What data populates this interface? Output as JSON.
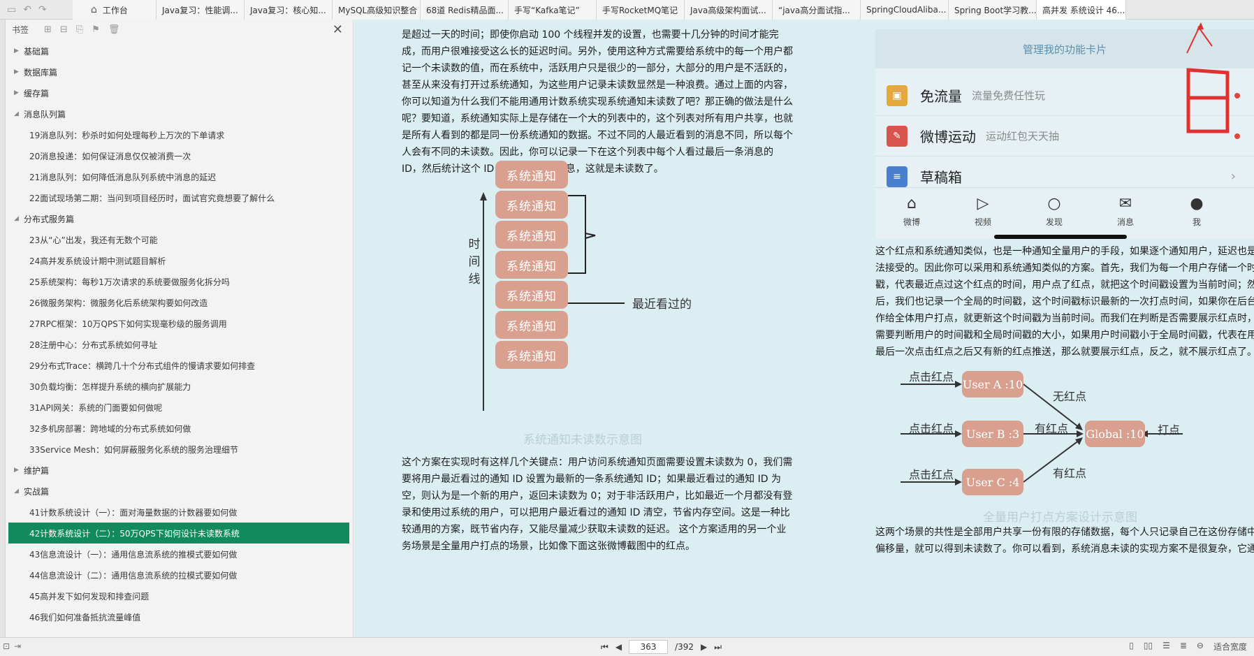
{
  "tabs": {
    "home": "工作台",
    "items": [
      "Java复习：性能调...",
      "Java复习：核心知...",
      "MySQL高级知识整合",
      "68道 Redis精品面...",
      "手写“Kafka笔记”",
      "手写RocketMQ笔记",
      "Java高级架构面试...",
      "“java高分面试指...",
      "SpringCloudAliba...",
      "Spring Boot学习教...",
      "高并发 系统设计 46..."
    ]
  },
  "sidebar": {
    "title": "书签",
    "sections": [
      {
        "label": "基础篇",
        "expanded": false,
        "items": []
      },
      {
        "label": "数据库篇",
        "expanded": false,
        "items": []
      },
      {
        "label": "缓存篇",
        "expanded": false,
        "items": []
      },
      {
        "label": "消息队列篇",
        "expanded": true,
        "items": [
          "19消息队列：秒杀时如何处理每秒上万次的下单请求",
          "20消息投递：如何保证消息仅仅被消费一次",
          "21消息队列：如何降低消息队列系统中消息的延迟",
          "22面试现场第二期：当问到项目经历时，面试官究竟想要了解什么"
        ]
      },
      {
        "label": "分布式服务篇",
        "expanded": true,
        "items": [
          "23从“心”出发，我还有无数个可能",
          "24高并发系统设计期中测试题目解析",
          "25系统架构：每秒1万次请求的系统要做服务化拆分吗",
          "26微服务架构：微服务化后系统架构要如何改造",
          "27RPC框架：10万QPS下如何实现毫秒级的服务调用",
          "28注册中心：分布式系统如何寻址",
          "29分布式Trace：横跨几十个分布式组件的慢请求要如何排查",
          "30负载均衡：怎样提升系统的横向扩展能力",
          "31API网关：系统的门面要如何做呢",
          "32多机房部署：跨地域的分布式系统如何做",
          "33Service Mesh：如何屏蔽服务化系统的服务治理细节"
        ]
      },
      {
        "label": "维护篇",
        "expanded": false,
        "items": []
      },
      {
        "label": "实战篇",
        "expanded": true,
        "items": [
          "41计数系统设计（一）：面对海量数据的计数器要如何做",
          "42计数系统设计（二）：50万QPS下如何设计未读数系统",
          "43信息流设计（一）：通用信息流系统的推模式要如何做",
          "44信息流设计（二）：通用信息流系统的拉模式要如何做",
          "45高并发下如何发现和排查问题",
          "46我们如何准备抵抗流量峰值"
        ]
      }
    ],
    "selected": "42计数系统设计（二）：50万QPS下如何设计未读数系统"
  },
  "content": {
    "para1": [
      "是超过一天的时间；即使你启动 100 个线程并发的设置，也需要十几分钟的时间才能完",
      "成，而用户很难接受这么长的延迟时间。另外，使用这种方式需要给系统中的每一个用户都",
      "记一个未读数的值，而在系统中，活跃用户只是很少的一部分，大部分的用户是不活跃的，",
      "甚至从来没有打开过系统通知，为这些用户记录未读数显然是一种浪费。通过上面的内容，",
      "你可以知道为什么我们不能用通用计数系统实现系统通知未读数了吧？那正确的做法是什么",
      "呢？要知道，系统通知实际上是存储在一个大的列表中的，这个列表对所有用户共享，也就",
      "是所有人看到的都是同一份系统通知的数据。不过不同的人最近看到的消息不同，所以每个",
      "人会有不同的未读数。因此，你可以记录一下在这个列表中每个人看过最后一条消息的",
      "ID，然后统计这个 ID 之后有多少条消息，这就是未读数了。"
    ],
    "diagram1": {
      "box_label": "系统通知",
      "box_count": 7,
      "timeline_label": "时间线",
      "recent_label": "最近看过的",
      "caption": "系统通知未读数示意图"
    },
    "para2": [
      "这个方案在实现时有这样几个关键点：用户访问系统通知页面需要设置未读数为 0，我们需",
      "要将用户最近看过的通知 ID 设置为最新的一条系统通知 ID；如果最近看过的通知 ID 为",
      "空，则认为是一个新的用户，返回未读数为 0；对于非活跃用户，比如最近一个月都没有登",
      "录和使用过系统的用户，可以把用户最近看过的通知 ID 清空，节省内存空间。这是一种比",
      "较通用的方案，既节省内存，又能尽量减少获取未读数的延迟。 这个方案适用的另一个业",
      "务场景是全量用户打点的场景，比如像下面这张微博截图中的红点。"
    ],
    "phone": {
      "header": "管理我的功能卡片",
      "rows": [
        {
          "title": "免流量",
          "sub": "流量免费任性玩",
          "color": "#e3a93a"
        },
        {
          "title": "微博运动",
          "sub": "运动红包天天抽",
          "color": "#d9534f"
        },
        {
          "title": "草稿箱",
          "sub": "",
          "color": "#4a7fd0"
        }
      ],
      "nav": [
        "微博",
        "视频",
        "发现",
        "消息",
        "我"
      ]
    },
    "para3": [
      "这个红点和系统通知类似，也是一种通知全量用户的手段，如果逐个通知用户，延迟也是无",
      "法接受的。因此你可以采用和系统通知类似的方案。首先，我们为每一个用户存储一个时间",
      "戳，代表最近点过这个红点的时间，用户点了红点，就把这个时间戳设置为当前时间；然",
      "后，我们也记录一个全局的时间戳，这个时间戳标识最新的一次打点时间，如果你在后台操",
      "作给全体用户打点，就更新这个时间戳为当前时间。而我们在判断是否需要展示红点时，只",
      "需要判断用户的时间戳和全局时间戳的大小，如果用户时间戳小于全局时间戳，代表在用户",
      "最后一次点击红点之后又有新的红点推送，那么就要展示红点，反之，就不展示红点了。"
    ],
    "diagram2": {
      "users": [
        "User A :10",
        "User B :3",
        "User C :4"
      ],
      "global": "Global :10",
      "click": "点击红点",
      "no_dot": "无红点",
      "has_dot": "有红点",
      "mark": "打点",
      "caption": "全量用户打点方案设计示意图"
    },
    "para4": [
      "这两个场景的共性是全部用户共享一份有限的存储数据，每个人只记录自己在这份存储中的",
      "偏移量，就可以得到未读数了。你可以看到，系统消息未读的实现方案不是很复杂，它通过"
    ]
  },
  "status": {
    "page": "363",
    "total": "/392",
    "fit": "适合宽度"
  }
}
